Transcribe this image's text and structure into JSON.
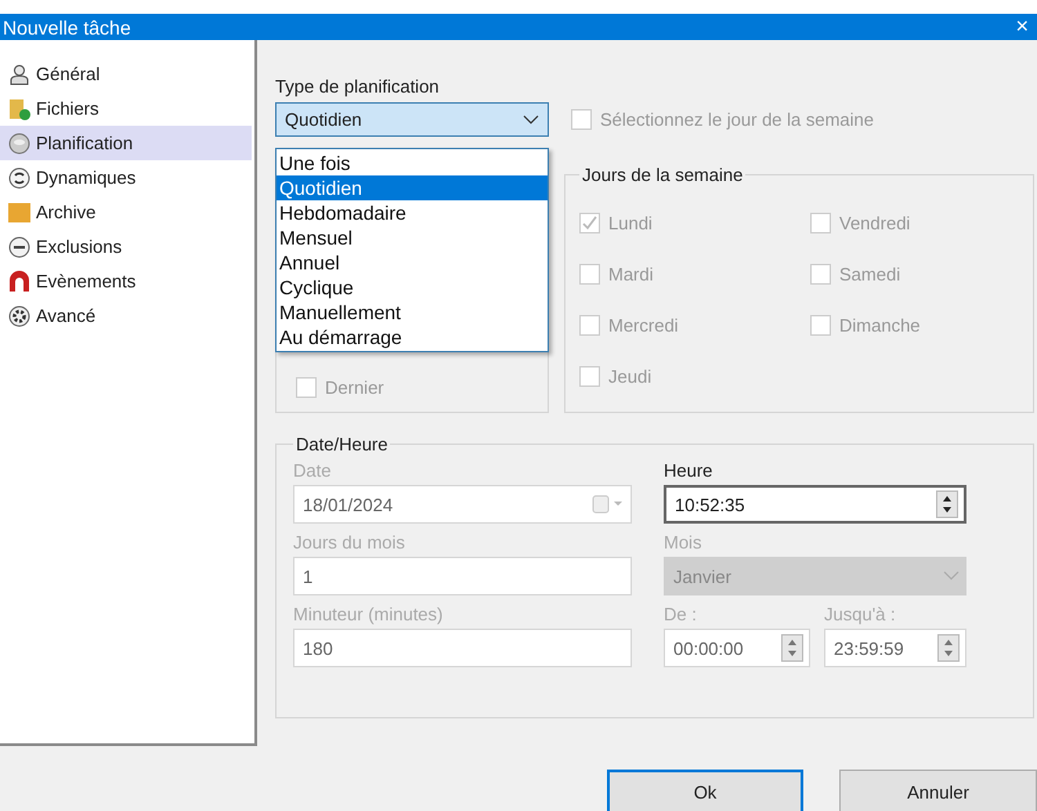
{
  "window": {
    "title": "Nouvelle tâche",
    "close": "×"
  },
  "sidebar": {
    "items": [
      {
        "label": "Général",
        "selected": false
      },
      {
        "label": "Fichiers",
        "selected": false
      },
      {
        "label": "Planification",
        "selected": true
      },
      {
        "label": "Dynamiques",
        "selected": false
      },
      {
        "label": "Archive",
        "selected": false
      },
      {
        "label": "Exclusions",
        "selected": false
      },
      {
        "label": "Evènements",
        "selected": false
      },
      {
        "label": "Avancé",
        "selected": false
      }
    ]
  },
  "schedule_type": {
    "label": "Type de planification",
    "value": "Quotidien",
    "expanded": true,
    "options": [
      {
        "label": "Une fois",
        "selected": false
      },
      {
        "label": "Quotidien",
        "selected": true
      },
      {
        "label": "Hebdomadaire",
        "selected": false
      },
      {
        "label": "Mensuel",
        "selected": false
      },
      {
        "label": "Annuel",
        "selected": false
      },
      {
        "label": "Cyclique",
        "selected": false
      },
      {
        "label": "Manuellement",
        "selected": false
      },
      {
        "label": "Au démarrage",
        "selected": false
      }
    ]
  },
  "weekday_toggle": {
    "label": "Sélectionnez le jour de la semaine",
    "checked": false
  },
  "left_group": {
    "items": [
      {
        "label": "Dernier",
        "checked": false
      }
    ]
  },
  "weekdays": {
    "title": "Jours de la semaine",
    "enabled": false,
    "days": [
      {
        "label": "Lundi",
        "checked": true
      },
      {
        "label": "Mardi",
        "checked": false
      },
      {
        "label": "Mercredi",
        "checked": false
      },
      {
        "label": "Jeudi",
        "checked": false
      },
      {
        "label": "Vendredi",
        "checked": false
      },
      {
        "label": "Samedi",
        "checked": false
      },
      {
        "label": "Dimanche",
        "checked": false
      }
    ]
  },
  "date_time": {
    "title": "Date/Heure",
    "fields": [
      {
        "kind": "date",
        "label": "Date",
        "value": "18/01/2024",
        "enabled": false
      },
      {
        "kind": "spin",
        "label": "Heure",
        "value": "10:52:35",
        "enabled": true
      },
      {
        "kind": "text",
        "label": "Jours du mois",
        "value": "1",
        "enabled": false
      },
      {
        "kind": "combo",
        "label": "Mois",
        "value": "Janvier",
        "enabled": false
      },
      {
        "kind": "text",
        "label": "Minuteur (minutes)",
        "value": "180",
        "enabled": false
      },
      {
        "kind": "spin",
        "label": "De :",
        "value": "00:00:00",
        "enabled": false
      },
      {
        "kind": "spin",
        "label": "Jusqu'à :",
        "value": "23:59:59",
        "enabled": false
      }
    ]
  },
  "buttons": [
    {
      "label": "Ok",
      "default": true
    },
    {
      "label": "Annuler",
      "default": false
    }
  ]
}
